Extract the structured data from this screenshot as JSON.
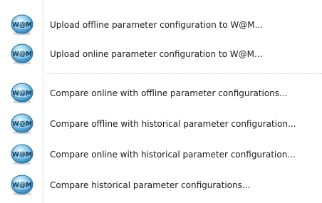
{
  "menu": {
    "icon_name": "wam-globe-icon",
    "icon_text": "W@M",
    "items": [
      {
        "label": "Upload offline parameter configuration to W@M..."
      },
      {
        "label": "Upload online parameter configuration to W@M..."
      },
      {
        "label": "Compare online with offline parameter configurations..."
      },
      {
        "label": "Compare offline with historical parameter configuration..."
      },
      {
        "label": "Compare online with historical parameter configuration..."
      },
      {
        "label": "Compare historical parameter configurations..."
      }
    ]
  },
  "colors": {
    "icon_light": "#a9dcf2",
    "icon_mid": "#4aa8d6",
    "icon_dark": "#1c6aa0",
    "icon_shadow": "#7d7d7d",
    "text": "#1a1a1a",
    "separator": "#c8c8c8"
  }
}
